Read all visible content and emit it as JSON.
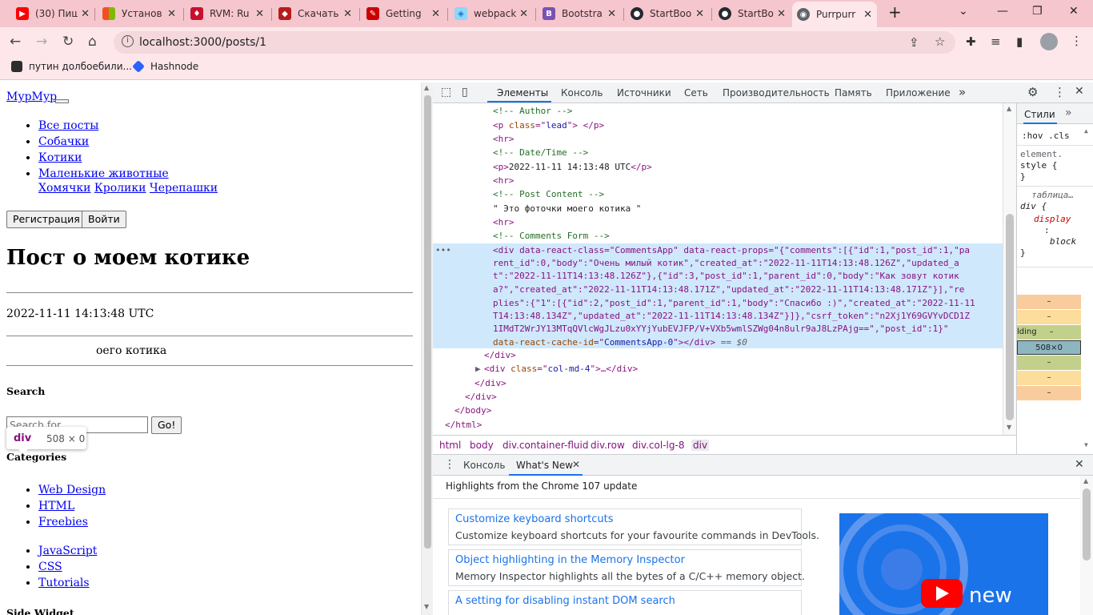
{
  "browser": {
    "tabs": [
      {
        "title": "(30) Пиш",
        "color": "#ff0000",
        "glyph": "▶"
      },
      {
        "title": "Установ",
        "color": "#f25022",
        "glyph": ""
      },
      {
        "title": "RVM: Ru",
        "color": "#c8102e",
        "glyph": "♦"
      },
      {
        "title": "Скачать",
        "color": "#b71c1c",
        "glyph": "◆"
      },
      {
        "title": "Getting",
        "color": "#cc0000",
        "glyph": "✎"
      },
      {
        "title": "webpack",
        "color": "#8ed6fb",
        "glyph": "◈"
      },
      {
        "title": "Bootstra",
        "color": "#7952b3",
        "glyph": "B"
      },
      {
        "title": "StartBoo",
        "color": "#24292f",
        "glyph": "●"
      },
      {
        "title": "StartBoo",
        "color": "#24292f",
        "glyph": "●"
      },
      {
        "title": "Purrpurr",
        "color": "#5f6368",
        "glyph": "◉"
      }
    ],
    "new_tab_icon": "+",
    "url": "localhost:3000/posts/1",
    "bookmarks": [
      {
        "label": "путин долбоебили...",
        "color": "#2d2d2d"
      },
      {
        "label": "Hashnode",
        "color": "#2962ff"
      }
    ]
  },
  "page": {
    "brand": "МурМур",
    "nav": [
      "Все посты",
      "Собачки",
      "Котики",
      "Маленькие животные"
    ],
    "subnav": [
      "Хомячки",
      "Кролики",
      "Черепашки"
    ],
    "register": "Регистрация",
    "login": "Войти",
    "post_title": "Пост о моем котике",
    "post_date": "2022-11-11 14:13:48 UTC",
    "post_body": "Это фоточки моего котика",
    "post_body_visible": "оего котика",
    "search_heading": "Search",
    "search_placeholder": "Search for...",
    "search_go": "Go!",
    "categories_heading": "Categories",
    "categories_a": [
      "Web Design",
      "HTML",
      "Freebies"
    ],
    "categories_b": [
      "JavaScript",
      "CSS",
      "Tutorials"
    ],
    "side_widget": "Side Widget",
    "tooltip_tag": "div",
    "tooltip_size": "508 × 0"
  },
  "devtools": {
    "tabs": [
      "Элементы",
      "Консоль",
      "Источники",
      "Сеть",
      "Производительность",
      "Память",
      "Приложение"
    ],
    "more": "»",
    "code": {
      "l1": "<!-- Author -->",
      "l2a": "<p ",
      "l2b": "class",
      "l2c": "=\"",
      "l2d": "lead",
      "l2e": "\"> </p>",
      "l3": "<hr>",
      "l4": "<!-- Date/Time -->",
      "l5a": "<p>",
      "l5b": "2022-11-11 14:13:48 UTC",
      "l5c": "</p>",
      "l6": "<hr>",
      "l7": "<!-- Post Content -->",
      "l8": "\" Это фоточки моего котика \"",
      "l9": "<hr>",
      "l10": "<!-- Comments Form -->",
      "s1": "<div data-react-class=\"CommentsApp\" data-react-props=\"{\"comments\":[{\"id\":1,\"post_id\":1,\"pa",
      "s2": "rent_id\":0,\"body\":\"Очень милый котик\",\"created_at\":\"2022-11-11T14:13:48.126Z\",\"updated_a",
      "s3": "t\":\"2022-11-11T14:13:48.126Z\"},{\"id\":3,\"post_id\":1,\"parent_id\":0,\"body\":\"Как зовут котик",
      "s4": "а?\",\"created_at\":\"2022-11-11T14:13:48.171Z\",\"updated_at\":\"2022-11-11T14:13:48.171Z\"}],\"re",
      "s5": "plies\":{\"1\":[{\"id\":2,\"post_id\":1,\"parent_id\":1,\"body\":\"Спасибо :)\",\"created_at\":\"2022-11-11",
      "s6": "T14:13:48.134Z\",\"updated_at\":\"2022-11-11T14:13:48.134Z\"}]},\"csrf_token\":\"n2Xj1Y69GVYvDCD1Z",
      "s7": "1IMdT2WrJY13MTqQVlcWgJLzu0xYYjYubEVJFP/V+VXb5wmlSZWg04n8ulr9aJ8LzPAjg==\",\"post_id\":1}\"",
      "s8a": "data-react-cache-id",
      "s8b": "=\"",
      "s8c": "CommentsApp-0",
      "s8d": "\"></div>",
      "s8e": " == $0",
      "c1": "</div>",
      "c2a": "<div ",
      "c2b": "class",
      "c2c": "=\"",
      "c2d": "col-md-4",
      "c2e": "\">…</div>",
      "c3": "</div>",
      "c4": "</div>",
      "c5": "</body>",
      "c6": "</html>"
    },
    "breadcrumbs": [
      "html",
      "body",
      "div.container-fluid",
      "div.row",
      "div.col-lg-8",
      "div"
    ],
    "styles_tab": "Стили",
    "styles_filter": ":hov .cls",
    "styles_rules": [
      "element.",
      "style {",
      "}",
      "таблица…",
      "div {",
      "display",
      ":",
      "block",
      "}"
    ],
    "box_model": [
      "–",
      "–",
      "lding",
      "–",
      "508×0",
      "–",
      "–",
      "–"
    ],
    "drawer_tabs": [
      "Консоль",
      "What's New"
    ],
    "drawer_heading": "Highlights from the Chrome 107 update",
    "cards": [
      {
        "title": "Customize keyboard shortcuts",
        "desc": "Customize keyboard shortcuts for your favourite commands in DevTools."
      },
      {
        "title": "Object highlighting in the Memory Inspector",
        "desc": "Memory Inspector highlights all the bytes of a C/C++ memory object."
      },
      {
        "title": "A setting for disabling instant DOM search",
        "desc": ""
      }
    ],
    "promo_text": "new"
  }
}
